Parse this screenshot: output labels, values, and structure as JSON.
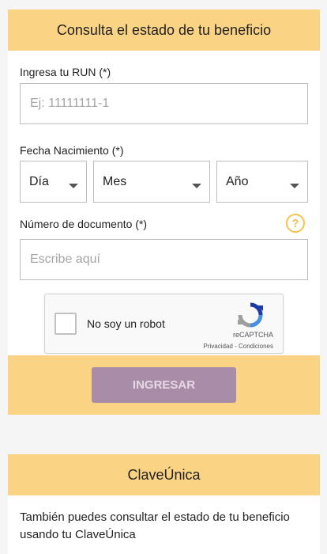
{
  "form": {
    "title": "Consulta el estado de tu beneficio",
    "run_label": "Ingresa tu RUN (*)",
    "run_placeholder": "Ej: 11111111-1",
    "birth_label": "Fecha Nacimiento (*)",
    "day_value": "Día",
    "month_value": "Mes",
    "year_value": "Año",
    "doc_label": "Número de documento (*)",
    "doc_placeholder": "Escribe aquí",
    "help_glyph": "?",
    "captcha": {
      "label": "No soy un robot",
      "brand": "reCAPTCHA",
      "links": "Privacidad - Condiciones"
    },
    "submit_label": "INGRESAR"
  },
  "clave": {
    "title": "ClaveÚnica",
    "description": "También puedes consultar el estado de tu beneficio usando tu ClaveÚnica"
  },
  "colors": {
    "accent": "#fad385",
    "button": "#a98ca8",
    "help": "#f3c24f"
  }
}
